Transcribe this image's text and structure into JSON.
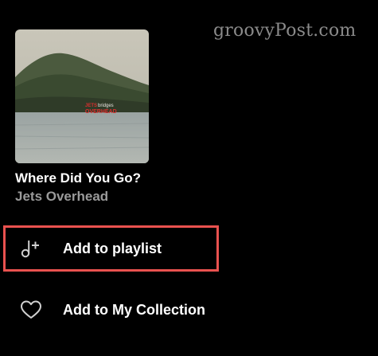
{
  "watermark": {
    "text": "groovyPost.com"
  },
  "track": {
    "title": "Where Did You Go?",
    "artist": "Jets Overhead",
    "cover_text_line1": "JETS",
    "cover_text_line2": "OVERHEAD",
    "cover_text_small": "bridges"
  },
  "menu": {
    "items": [
      {
        "label": "Add to playlist",
        "icon": "add-to-playlist-icon",
        "highlighted": true
      },
      {
        "label": "Add to My Collection",
        "icon": "heart-icon",
        "highlighted": false
      }
    ]
  },
  "colors": {
    "background": "#000000",
    "highlight_border": "#e9524f",
    "artist_text": "#9a9a9a",
    "watermark": "#8a8a8a"
  }
}
